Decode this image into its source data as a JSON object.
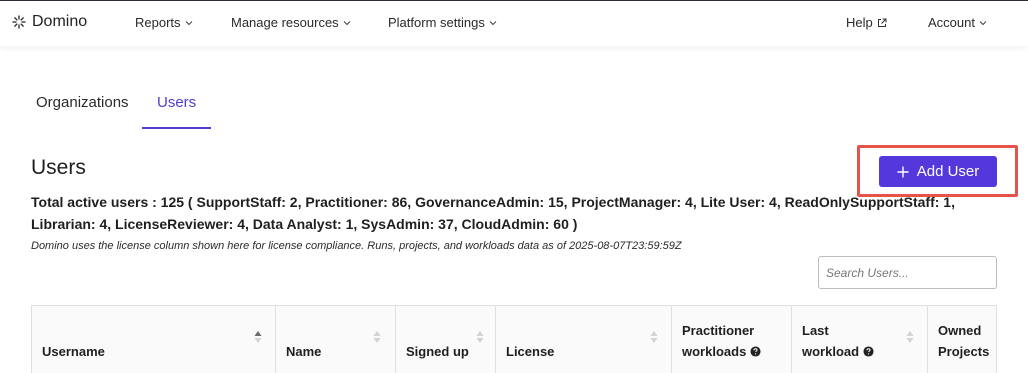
{
  "nav": {
    "brand": "Domino",
    "items": [
      {
        "label": "Reports"
      },
      {
        "label": "Manage resources"
      },
      {
        "label": "Platform settings"
      }
    ],
    "help": "Help",
    "account": "Account"
  },
  "tabs": [
    {
      "label": "Organizations",
      "active": false
    },
    {
      "label": "Users",
      "active": true
    }
  ],
  "page": {
    "title": "Users",
    "add_button": "Add User",
    "summary": "Total active users : 125 ( SupportStaff: 2, Practitioner: 86, GovernanceAdmin: 15, ProjectManager: 4, Lite User: 4, ReadOnlySupportStaff: 1, Librarian: 4, LicenseReviewer: 4, Data Analyst: 1, SysAdmin: 37, CloudAdmin: 60 )",
    "note": "Domino uses the license column shown here for license compliance. Runs, projects, and workloads data as of 2025-08-07T23:59:59Z"
  },
  "search": {
    "placeholder": "Search Users..."
  },
  "table": {
    "columns": [
      {
        "line1": "",
        "line2": "Username"
      },
      {
        "line1": "",
        "line2": "Name"
      },
      {
        "line1": "",
        "line2": "Signed up"
      },
      {
        "line1": "",
        "line2": "License"
      },
      {
        "line1": "Practitioner",
        "line2": "workloads"
      },
      {
        "line1": "Last",
        "line2": "workload"
      },
      {
        "line1": "Owned",
        "line2": "Projects"
      }
    ]
  },
  "colors": {
    "accent": "#5438dc",
    "highlight": "#e5534b"
  }
}
